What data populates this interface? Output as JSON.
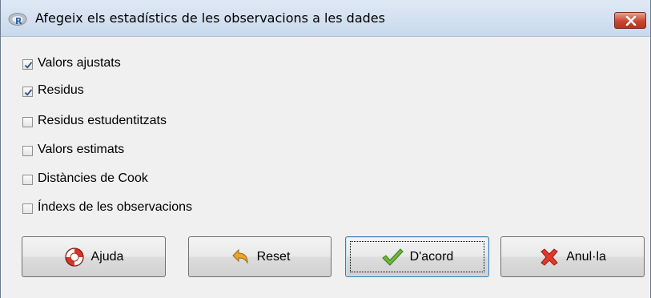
{
  "window": {
    "title": "Afegeix els estadístics de les observacions a les dades",
    "app_icon": "r-logo-icon",
    "close_icon": "close-icon"
  },
  "options": [
    {
      "label": "Valors ajustats",
      "checked": true
    },
    {
      "label": "Residus",
      "checked": true
    },
    {
      "label": "Residus estudentitzats",
      "checked": false
    },
    {
      "label": "Valors estimats",
      "checked": false
    },
    {
      "label": "Distàncies de Cook",
      "checked": false
    },
    {
      "label": "Índexs de les observacions",
      "checked": false
    }
  ],
  "buttons": {
    "help": {
      "label": "Ajuda",
      "icon": "lifebuoy-icon"
    },
    "reset": {
      "label": "Reset",
      "icon": "undo-arrow-icon"
    },
    "ok": {
      "label": "D'acord",
      "icon": "checkmark-icon",
      "focused": true
    },
    "cancel": {
      "label": "Anul·la",
      "icon": "red-x-icon"
    }
  },
  "colors": {
    "titlebar": "#c9d9ec",
    "dialog_bg": "#f0f0f0",
    "close_red": "#c7472f"
  }
}
